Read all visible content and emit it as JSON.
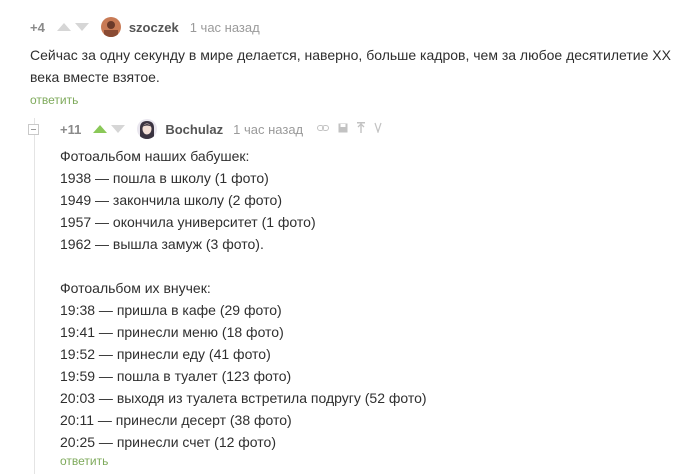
{
  "comment1": {
    "rating": "+4",
    "author": "szoczek",
    "time": "1 час назад",
    "text": "Сейчас за одну секунду в мире делается, наверно, больше кадров, чем за любое десятилетие XX века вместе взятое.",
    "reply_label": "ответить"
  },
  "comment2": {
    "rating": "+11",
    "author": "Bochulaz",
    "time": "1 час назад",
    "lines": [
      "Фотоальбом наших бабушек:",
      "1938 — пошла в школу (1 фото)",
      "1949 — закончила школу (2 фото)",
      "1957 — окончила университет (1 фото)",
      "1962 — вышла замуж (3 фото).",
      "",
      "Фотоальбом их внучек:",
      "19:38 — пришла в кафе (29 фото)",
      "19:41 — принесли меню (18 фото)",
      "19:52 — принесли еду (41 фото)",
      "19:59 — пошла в туалет (123 фото)",
      "20:03 — выходя из туалета встретила подругу (52 фото)",
      "20:11 — принесли десерт (38 фото)",
      "20:25 — принесли счет (12 фото)"
    ],
    "reply_label": "ответить"
  },
  "colors": {
    "accent_green": "#8ac858",
    "link_green": "#7da95a",
    "muted": "#9a9a9a"
  },
  "icons": [
    "upvote-icon",
    "downvote-icon",
    "link-icon",
    "save-icon",
    "pin-icon",
    "text-icon",
    "collapse-icon"
  ]
}
